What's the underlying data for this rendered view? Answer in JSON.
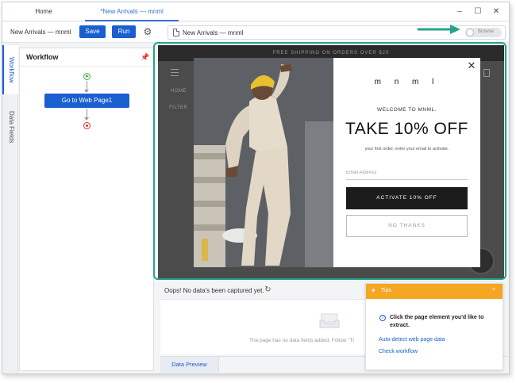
{
  "tabs": {
    "home": "Home",
    "active": "*New Arrivals — mnml"
  },
  "toolbar": {
    "task_name": "New Arrivals — mnml",
    "save_label": "Save",
    "run_label": "Run",
    "url": "New Arrivals — mnml",
    "browse_label": "Browse"
  },
  "side_tabs": {
    "workflow": "Workflow",
    "data_fields": "Data Fields"
  },
  "workflow": {
    "title": "Workflow",
    "step": "Go to Web Page1"
  },
  "website": {
    "banner": "FREE SHIPPING ON ORDERS OVER $20",
    "nav_home": "HOME",
    "filter": "FILTER",
    "popup": {
      "brand": "m n m l",
      "welcome": "WELCOME TO MNML.",
      "headline": "TAKE 10% OFF",
      "subtext": "your first order. enter your email to activate.",
      "email_placeholder": "Email Address",
      "activate_label": "ACTIVATE 10% OFF",
      "no_thanks_label": "NO THANKS"
    }
  },
  "data_preview": {
    "status": "Oops! No data's been captured yet.",
    "empty_message": "The page has no data fields added. Follow \"Ti",
    "tab_label": "Data Preview"
  },
  "tips": {
    "title": "Tips",
    "message": "Click the page element you'd like to extract.",
    "link_autodetect": "Auto-detect web page data",
    "link_workflow": "Check workflow"
  },
  "colors": {
    "primary": "#1a5fd0",
    "highlight": "#24a38a",
    "tips_header": "#f5a623"
  }
}
